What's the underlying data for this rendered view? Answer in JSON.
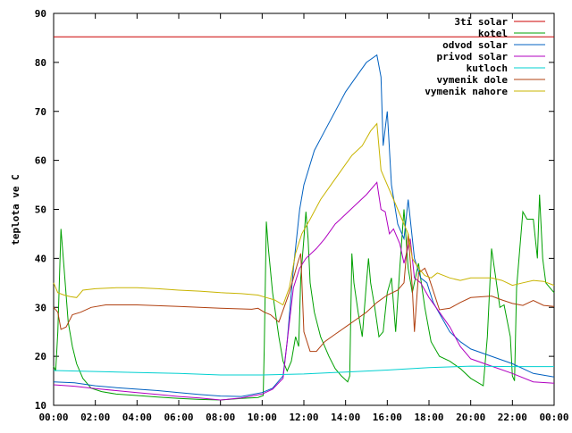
{
  "chart_data": {
    "type": "line",
    "title": "",
    "xlabel": "",
    "ylabel": "teplota ve C",
    "x_ticks": [
      "00:00",
      "02:00",
      "04:00",
      "06:00",
      "08:00",
      "10:00",
      "12:00",
      "14:00",
      "16:00",
      "18:00",
      "20:00",
      "22:00",
      "00:00"
    ],
    "y_ticks": [
      10,
      20,
      30,
      40,
      50,
      60,
      70,
      80,
      90
    ],
    "xlim": [
      0,
      24
    ],
    "ylim": [
      10,
      90
    ],
    "grid": false,
    "legend_position": "top-right",
    "series": [
      {
        "name": "3ti solar",
        "color": "#cc0000",
        "points": [
          [
            0,
            85.2
          ],
          [
            24,
            85.2
          ]
        ]
      },
      {
        "name": "kotel",
        "color": "#00a000",
        "points": [
          [
            0,
            18
          ],
          [
            0.1,
            17
          ],
          [
            0.2,
            25
          ],
          [
            0.35,
            46
          ],
          [
            0.5,
            38
          ],
          [
            0.7,
            27
          ],
          [
            0.9,
            22
          ],
          [
            1.1,
            18.5
          ],
          [
            1.4,
            15.5
          ],
          [
            1.8,
            13.5
          ],
          [
            2.3,
            12.8
          ],
          [
            3,
            12.3
          ],
          [
            4,
            12
          ],
          [
            5,
            11.7
          ],
          [
            6,
            11.4
          ],
          [
            7,
            11.2
          ],
          [
            8,
            11.1
          ],
          [
            9,
            11.4
          ],
          [
            9.8,
            11.6
          ],
          [
            10.05,
            12
          ],
          [
            10.1,
            22
          ],
          [
            10.2,
            47.5
          ],
          [
            10.3,
            42
          ],
          [
            10.5,
            33
          ],
          [
            10.8,
            24
          ],
          [
            11.0,
            19
          ],
          [
            11.2,
            17
          ],
          [
            11.4,
            19
          ],
          [
            11.6,
            24
          ],
          [
            11.75,
            22
          ],
          [
            11.85,
            36
          ],
          [
            12.0,
            44
          ],
          [
            12.1,
            49.5
          ],
          [
            12.2,
            44
          ],
          [
            12.3,
            35
          ],
          [
            12.5,
            29
          ],
          [
            12.8,
            24
          ],
          [
            13.2,
            20
          ],
          [
            13.5,
            17.5
          ],
          [
            13.8,
            16
          ],
          [
            14.1,
            14.8
          ],
          [
            14.2,
            16
          ],
          [
            14.3,
            41
          ],
          [
            14.4,
            35
          ],
          [
            14.6,
            29
          ],
          [
            14.8,
            24
          ],
          [
            15.0,
            35
          ],
          [
            15.1,
            40
          ],
          [
            15.2,
            35
          ],
          [
            15.4,
            30
          ],
          [
            15.6,
            24
          ],
          [
            15.8,
            25
          ],
          [
            16.0,
            33
          ],
          [
            16.2,
            36
          ],
          [
            16.4,
            25
          ],
          [
            16.6,
            38
          ],
          [
            16.8,
            50
          ],
          [
            17.0,
            38
          ],
          [
            17.2,
            33
          ],
          [
            17.5,
            39
          ],
          [
            17.8,
            30
          ],
          [
            18.1,
            23
          ],
          [
            18.5,
            20
          ],
          [
            19,
            19
          ],
          [
            19.5,
            17.5
          ],
          [
            20,
            15.5
          ],
          [
            20.6,
            14
          ],
          [
            20.8,
            24
          ],
          [
            21.0,
            42
          ],
          [
            21.2,
            36
          ],
          [
            21.4,
            30
          ],
          [
            21.6,
            30.5
          ],
          [
            21.9,
            24
          ],
          [
            22.0,
            16
          ],
          [
            22.1,
            15
          ],
          [
            22.2,
            34
          ],
          [
            22.5,
            49.5
          ],
          [
            22.7,
            48
          ],
          [
            23.0,
            48
          ],
          [
            23.2,
            40
          ],
          [
            23.3,
            53
          ],
          [
            23.45,
            40
          ],
          [
            23.6,
            35
          ],
          [
            23.8,
            34
          ],
          [
            24,
            33
          ]
        ]
      },
      {
        "name": "odvod solar",
        "color": "#0060c0",
        "points": [
          [
            0,
            14.8
          ],
          [
            1,
            14.6
          ],
          [
            2,
            14
          ],
          [
            3,
            13.6
          ],
          [
            4,
            13.3
          ],
          [
            5,
            13
          ],
          [
            6,
            12.6
          ],
          [
            7,
            12.2
          ],
          [
            8,
            11.9
          ],
          [
            9,
            11.8
          ],
          [
            10,
            12.6
          ],
          [
            10.5,
            13.5
          ],
          [
            11,
            16
          ],
          [
            11.2,
            23
          ],
          [
            11.5,
            38
          ],
          [
            11.8,
            50
          ],
          [
            12,
            55
          ],
          [
            12.5,
            62
          ],
          [
            13,
            66
          ],
          [
            13.5,
            70
          ],
          [
            14,
            74
          ],
          [
            14.5,
            77
          ],
          [
            15,
            80
          ],
          [
            15.5,
            81.5
          ],
          [
            15.7,
            77
          ],
          [
            15.8,
            63
          ],
          [
            16,
            70
          ],
          [
            16.2,
            55
          ],
          [
            16.5,
            47
          ],
          [
            16.8,
            44
          ],
          [
            17,
            52
          ],
          [
            17.3,
            40
          ],
          [
            17.6,
            36
          ],
          [
            17.9,
            35
          ],
          [
            18.2,
            31
          ],
          [
            18.6,
            28
          ],
          [
            19,
            25
          ],
          [
            19.5,
            23
          ],
          [
            20,
            21.5
          ],
          [
            21,
            20
          ],
          [
            22,
            18.5
          ],
          [
            23,
            16.5
          ],
          [
            24,
            15.8
          ]
        ]
      },
      {
        "name": "privod solar",
        "color": "#b000c0",
        "points": [
          [
            0,
            14.2
          ],
          [
            1,
            13.9
          ],
          [
            2,
            13.4
          ],
          [
            3,
            13
          ],
          [
            4,
            12.6
          ],
          [
            5,
            12.2
          ],
          [
            6,
            11.8
          ],
          [
            7,
            11.5
          ],
          [
            8,
            11.1
          ],
          [
            9,
            11.5
          ],
          [
            10,
            12.3
          ],
          [
            10.5,
            13.3
          ],
          [
            11,
            15.5
          ],
          [
            11.2,
            23
          ],
          [
            11.5,
            34
          ],
          [
            11.8,
            38
          ],
          [
            12.1,
            40
          ],
          [
            12.6,
            42
          ],
          [
            13,
            44
          ],
          [
            13.5,
            47
          ],
          [
            14,
            49
          ],
          [
            14.5,
            51
          ],
          [
            15,
            53
          ],
          [
            15.5,
            55.5
          ],
          [
            15.7,
            50
          ],
          [
            15.9,
            49.5
          ],
          [
            16.1,
            45
          ],
          [
            16.3,
            46
          ],
          [
            16.6,
            43
          ],
          [
            16.8,
            39
          ],
          [
            17.1,
            44
          ],
          [
            17.3,
            36
          ],
          [
            17.6,
            35
          ],
          [
            18,
            32
          ],
          [
            18.5,
            29
          ],
          [
            19,
            26
          ],
          [
            19.5,
            22
          ],
          [
            20,
            19.5
          ],
          [
            21,
            18
          ],
          [
            22,
            16.5
          ],
          [
            23,
            14.8
          ],
          [
            24,
            14.5
          ]
        ]
      },
      {
        "name": "kutloch",
        "color": "#00d0d0",
        "points": [
          [
            0,
            17.1
          ],
          [
            2,
            16.9
          ],
          [
            4,
            16.7
          ],
          [
            6,
            16.5
          ],
          [
            8,
            16.2
          ],
          [
            10,
            16.2
          ],
          [
            12,
            16.4
          ],
          [
            14,
            16.8
          ],
          [
            16,
            17.2
          ],
          [
            18,
            17.7
          ],
          [
            20,
            18
          ],
          [
            22,
            17.9
          ],
          [
            24,
            17.9
          ]
        ]
      },
      {
        "name": "vymenik dole",
        "color": "#b04010",
        "points": [
          [
            0,
            30
          ],
          [
            0.2,
            29
          ],
          [
            0.35,
            25.5
          ],
          [
            0.6,
            26
          ],
          [
            0.9,
            28.5
          ],
          [
            1.3,
            29
          ],
          [
            1.8,
            30
          ],
          [
            2.5,
            30.5
          ],
          [
            4,
            30.5
          ],
          [
            6,
            30.2
          ],
          [
            8,
            29.8
          ],
          [
            9.5,
            29.6
          ],
          [
            9.8,
            29.8
          ],
          [
            10.1,
            29
          ],
          [
            10.4,
            28.5
          ],
          [
            10.8,
            27
          ],
          [
            11.3,
            33
          ],
          [
            11.7,
            39
          ],
          [
            11.85,
            41
          ],
          [
            12,
            25
          ],
          [
            12.3,
            21
          ],
          [
            12.6,
            21
          ],
          [
            13,
            23
          ],
          [
            13.5,
            24.5
          ],
          [
            14,
            26
          ],
          [
            14.5,
            27.5
          ],
          [
            15,
            29
          ],
          [
            15.5,
            31
          ],
          [
            16,
            32.5
          ],
          [
            16.5,
            33.5
          ],
          [
            16.8,
            35
          ],
          [
            17,
            45
          ],
          [
            17.2,
            34
          ],
          [
            17.3,
            25
          ],
          [
            17.5,
            37
          ],
          [
            17.8,
            38
          ],
          [
            18,
            36
          ],
          [
            18.5,
            29.5
          ],
          [
            19,
            29.8
          ],
          [
            19.5,
            31
          ],
          [
            20,
            32
          ],
          [
            21,
            32.3
          ],
          [
            21.5,
            31.5
          ],
          [
            22,
            30.8
          ],
          [
            22.5,
            30.4
          ],
          [
            23,
            31.4
          ],
          [
            23.5,
            30.4
          ],
          [
            24,
            30.2
          ]
        ]
      },
      {
        "name": "vymenik nahore",
        "color": "#c8b400",
        "points": [
          [
            0,
            35
          ],
          [
            0.2,
            33
          ],
          [
            0.5,
            32.5
          ],
          [
            0.8,
            32.2
          ],
          [
            1.1,
            32
          ],
          [
            1.4,
            33.5
          ],
          [
            2,
            33.8
          ],
          [
            3,
            34
          ],
          [
            4,
            34
          ],
          [
            5,
            33.8
          ],
          [
            6,
            33.5
          ],
          [
            7,
            33.3
          ],
          [
            8,
            33
          ],
          [
            9,
            32.8
          ],
          [
            9.8,
            32.5
          ],
          [
            10.2,
            32
          ],
          [
            10.6,
            31.5
          ],
          [
            11,
            30.5
          ],
          [
            11.3,
            34
          ],
          [
            11.6,
            41
          ],
          [
            11.9,
            45
          ],
          [
            12.3,
            48
          ],
          [
            12.8,
            52
          ],
          [
            13.3,
            55
          ],
          [
            13.8,
            58
          ],
          [
            14.3,
            61
          ],
          [
            14.8,
            63
          ],
          [
            15.2,
            66
          ],
          [
            15.5,
            67.5
          ],
          [
            15.7,
            58
          ],
          [
            16.0,
            55
          ],
          [
            16.4,
            51
          ],
          [
            16.7,
            48
          ],
          [
            17.0,
            45
          ],
          [
            17.2,
            40
          ],
          [
            17.5,
            38
          ],
          [
            17.8,
            36.5
          ],
          [
            18.1,
            36
          ],
          [
            18.4,
            37
          ],
          [
            19,
            36
          ],
          [
            19.5,
            35.5
          ],
          [
            20,
            36
          ],
          [
            21,
            36
          ],
          [
            21.5,
            35.5
          ],
          [
            22,
            34.5
          ],
          [
            22.5,
            35
          ],
          [
            23,
            35.5
          ],
          [
            23.5,
            35.3
          ],
          [
            24,
            34.5
          ]
        ]
      }
    ]
  }
}
